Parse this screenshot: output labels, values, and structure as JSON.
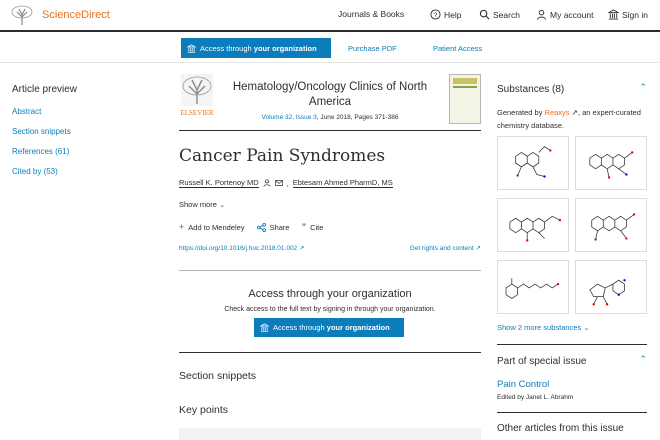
{
  "header": {
    "brand": "ScienceDirect",
    "nav": {
      "journals": "Journals & Books",
      "help": "Help",
      "search": "Search",
      "account": "My account",
      "signin": "Sign in"
    }
  },
  "subbar": {
    "access_prefix": "Access through ",
    "access_bold": "your organization",
    "purchase": "Purchase PDF",
    "patient": "Patient Access"
  },
  "left": {
    "title": "Article preview",
    "items": [
      "Abstract",
      "Section snippets",
      "References (61)",
      "Cited by (53)"
    ]
  },
  "article": {
    "journal": "Hematology/Oncology Clinics of North America",
    "volume_link": "Volume 32, Issue 3",
    "volume_rest": ", June 2018, Pages 371-386",
    "title": "Cancer Pain Syndromes",
    "author1": "Russell K. Portenoy MD",
    "author2": "Ebtesam Ahmed PharmD, MS",
    "show_more": "Show more",
    "add_mendeley": "Add to Mendeley",
    "share": "Share",
    "cite": "Cite",
    "doi": "https://doi.org/10.1016/j.hoc.2018.01.002",
    "rights": "Get rights and content",
    "access_heading": "Access through your organization",
    "access_text": "Check access to the full text by signing in through your organization.",
    "access_btn_prefix": "Access through ",
    "access_btn_bold": "your organization",
    "section_snippets": "Section snippets",
    "key_points": "Key points"
  },
  "right": {
    "substances": "Substances (8)",
    "gen_prefix": "Generated by ",
    "reaxys": "Reaxys",
    "gen_suffix": ", an expert-curated chemistry database.",
    "show_more_substances": "Show 2 more substances",
    "special_issue": "Part of special issue",
    "pain_control": "Pain Control",
    "edited_by": "Edited by Janet L. Abrahm",
    "other_articles": "Other articles from this issue"
  },
  "colors": {
    "accent": "#0c7dbb",
    "brand": "#e9711c",
    "text": "#2e2e2e"
  }
}
